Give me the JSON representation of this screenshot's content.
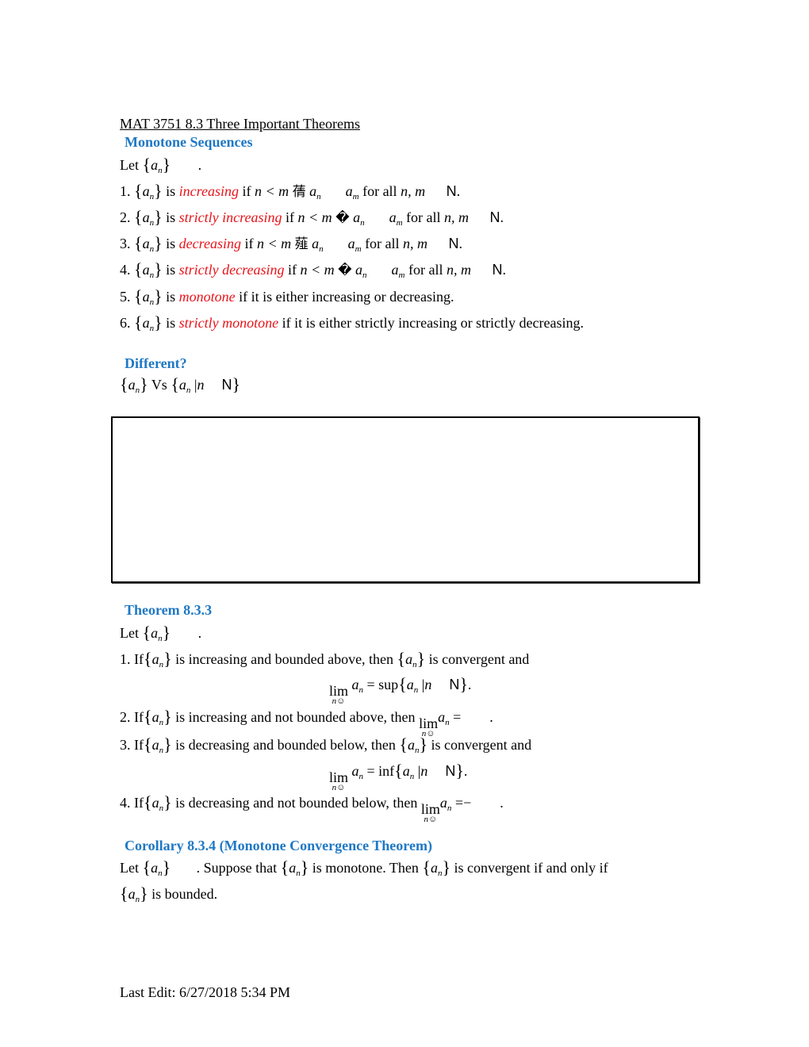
{
  "title": "MAT 3751 8.3 Three Important Theorems",
  "colors": {
    "heading": "#1f78c4",
    "definition": "#e8141b"
  },
  "monotone": {
    "heading": "Monotone Sequences",
    "let": "Let",
    "seq": "a",
    "seq_sub": "n",
    "period": ".",
    "items": [
      {
        "num": "1.",
        "is": "is",
        "term": "increasing",
        "cond_if": "if",
        "cond": "n < m",
        "arrow_glyph": "蒨",
        "a_n": "a",
        "a_m": "a",
        "for_all": "for all",
        "vars": "n, m",
        "set": "N",
        "end": "."
      },
      {
        "num": "2.",
        "is": "is",
        "term": "strictly increasing",
        "cond_if": "if",
        "cond": "n < m",
        "arrow_glyph": "�",
        "a_n": "a",
        "a_m": "a",
        "for_all": "for all",
        "vars": "n, m",
        "set": "N",
        "end": "."
      },
      {
        "num": "3.",
        "is": "is",
        "term": "decreasing",
        "cond_if": "if",
        "cond": "n < m",
        "arrow_glyph": "薤",
        "a_n": "a",
        "a_m": "a",
        "for_all": "for all",
        "vars": "n, m",
        "set": "N",
        "end": "."
      },
      {
        "num": "4.",
        "is": "is",
        "term": "strictly decreasing",
        "cond_if": "if",
        "cond": "n < m",
        "arrow_glyph": "�",
        "a_n": "a",
        "a_m": "a",
        "for_all": "for all",
        "vars": "n, m",
        "set": "N",
        "end": "."
      }
    ],
    "item5": {
      "num": "5.",
      "is": "is",
      "term": "monotone",
      "rest": "if it is either increasing or decreasing."
    },
    "item6": {
      "num": "6.",
      "is": "is",
      "term": "strictly monotone",
      "rest": "if it is either strictly increasing or strictly decreasing."
    }
  },
  "different": {
    "heading": "Different?",
    "vs": "Vs",
    "bar": "|",
    "n": "n",
    "set": "N"
  },
  "theorem": {
    "heading": "Theorem 8.3.3",
    "let": "Let",
    "lim_word": "lim",
    "lim_under": "n☺",
    "eq": "=",
    "item1": {
      "num": "1. If",
      "text": "is increasing and bounded above, then",
      "text2": "is convergent and",
      "op": "sup",
      "end": "."
    },
    "item2": {
      "num": "2. If",
      "text": "is increasing and not bounded above, then",
      "rhs": "",
      "end": "."
    },
    "item3": {
      "num": "3. If",
      "text": "is decreasing and bounded below, then",
      "text2": "is convergent and",
      "op": "inf",
      "end": "."
    },
    "item4": {
      "num": "4. If",
      "text": "is decreasing and not bounded below, then",
      "rhs": "−",
      "end": "."
    }
  },
  "corollary": {
    "heading": "Corollary 8.3.4 (Monotone Convergence Theorem)",
    "let": "Let",
    "text1": ". Suppose that",
    "text2": "is monotone. Then",
    "text3": "is convergent if and only if",
    "text4": "is bounded."
  },
  "footer": "Last Edit: 6/27/2018 5:34 PM"
}
